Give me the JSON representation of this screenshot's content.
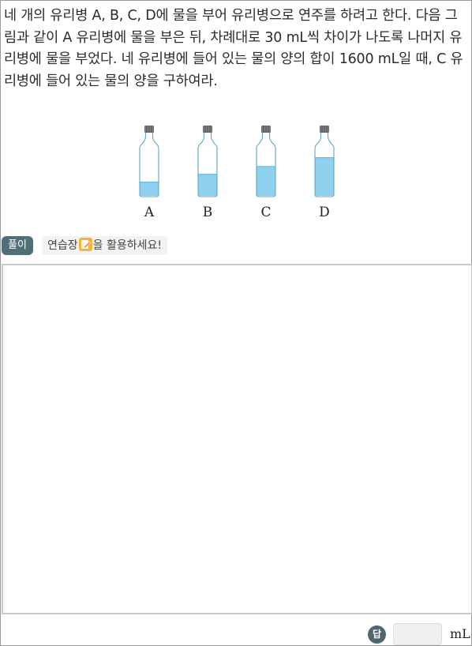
{
  "question": {
    "text": "네 개의 유리병 A, B, C, D에 물을 부어 유리병으로 연주를 하려고 한다. 다음 그림과 같이 A 유리병에 물을 부은 뒤, 차례대로 30 mL씩 차이가 나도록 나머지 유리병에 물을 부었다. 네 유리병에 들어 있는 물의 양의 합이 1600 mL일 때, C 유리병에 들어 있는 물의 양을 구하여라."
  },
  "figure": {
    "bottles": [
      {
        "label": "A",
        "water_fraction": 0.28
      },
      {
        "label": "B",
        "water_fraction": 0.44
      },
      {
        "label": "C",
        "water_fraction": 0.6
      },
      {
        "label": "D",
        "water_fraction": 0.78
      }
    ],
    "colors": {
      "water": "#8fd0ee",
      "water_edge": "#6cb9de",
      "glass": "#5fa7c4",
      "cap": "#666666"
    }
  },
  "solve": {
    "badge_label": "풀이",
    "pad_hint_before": "연습장",
    "pad_hint_after": "을 활용하세요!"
  },
  "answer": {
    "badge_label": "답",
    "value": "",
    "unit": "mL"
  }
}
